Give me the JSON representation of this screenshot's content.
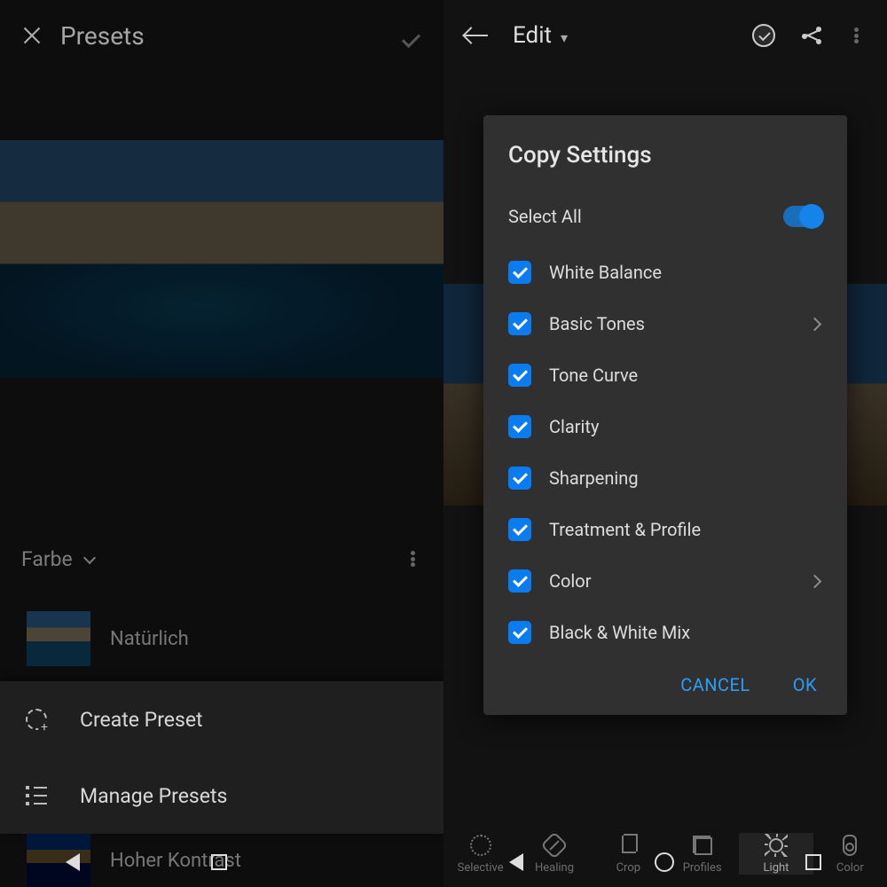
{
  "left": {
    "title": "Presets",
    "group_name": "Farbe",
    "presets": [
      {
        "label": "Natürlich"
      },
      {
        "label": "Hoher Kontrast"
      }
    ],
    "sheet": {
      "create": "Create Preset",
      "manage": "Manage Presets"
    }
  },
  "right": {
    "title": "Edit",
    "toolbar": [
      {
        "id": "selective",
        "label": "Selective"
      },
      {
        "id": "healing",
        "label": "Healing"
      },
      {
        "id": "crop",
        "label": "Crop"
      },
      {
        "id": "profiles",
        "label": "Profiles"
      },
      {
        "id": "light",
        "label": "Light"
      },
      {
        "id": "color",
        "label": "Color"
      }
    ]
  },
  "dialog": {
    "title": "Copy Settings",
    "select_all": "Select All",
    "items": [
      {
        "label": "White Balance",
        "checked": true,
        "expandable": false
      },
      {
        "label": "Basic Tones",
        "checked": true,
        "expandable": true
      },
      {
        "label": "Tone Curve",
        "checked": true,
        "expandable": false
      },
      {
        "label": "Clarity",
        "checked": true,
        "expandable": false
      },
      {
        "label": "Sharpening",
        "checked": true,
        "expandable": false
      },
      {
        "label": "Treatment & Profile",
        "checked": true,
        "expandable": false
      },
      {
        "label": "Color",
        "checked": true,
        "expandable": true
      },
      {
        "label": "Black & White Mix",
        "checked": true,
        "expandable": false
      }
    ],
    "cancel": "CANCEL",
    "ok": "OK"
  },
  "colors": {
    "accent": "#1583ea",
    "check_blue": "#0a7cf0"
  }
}
